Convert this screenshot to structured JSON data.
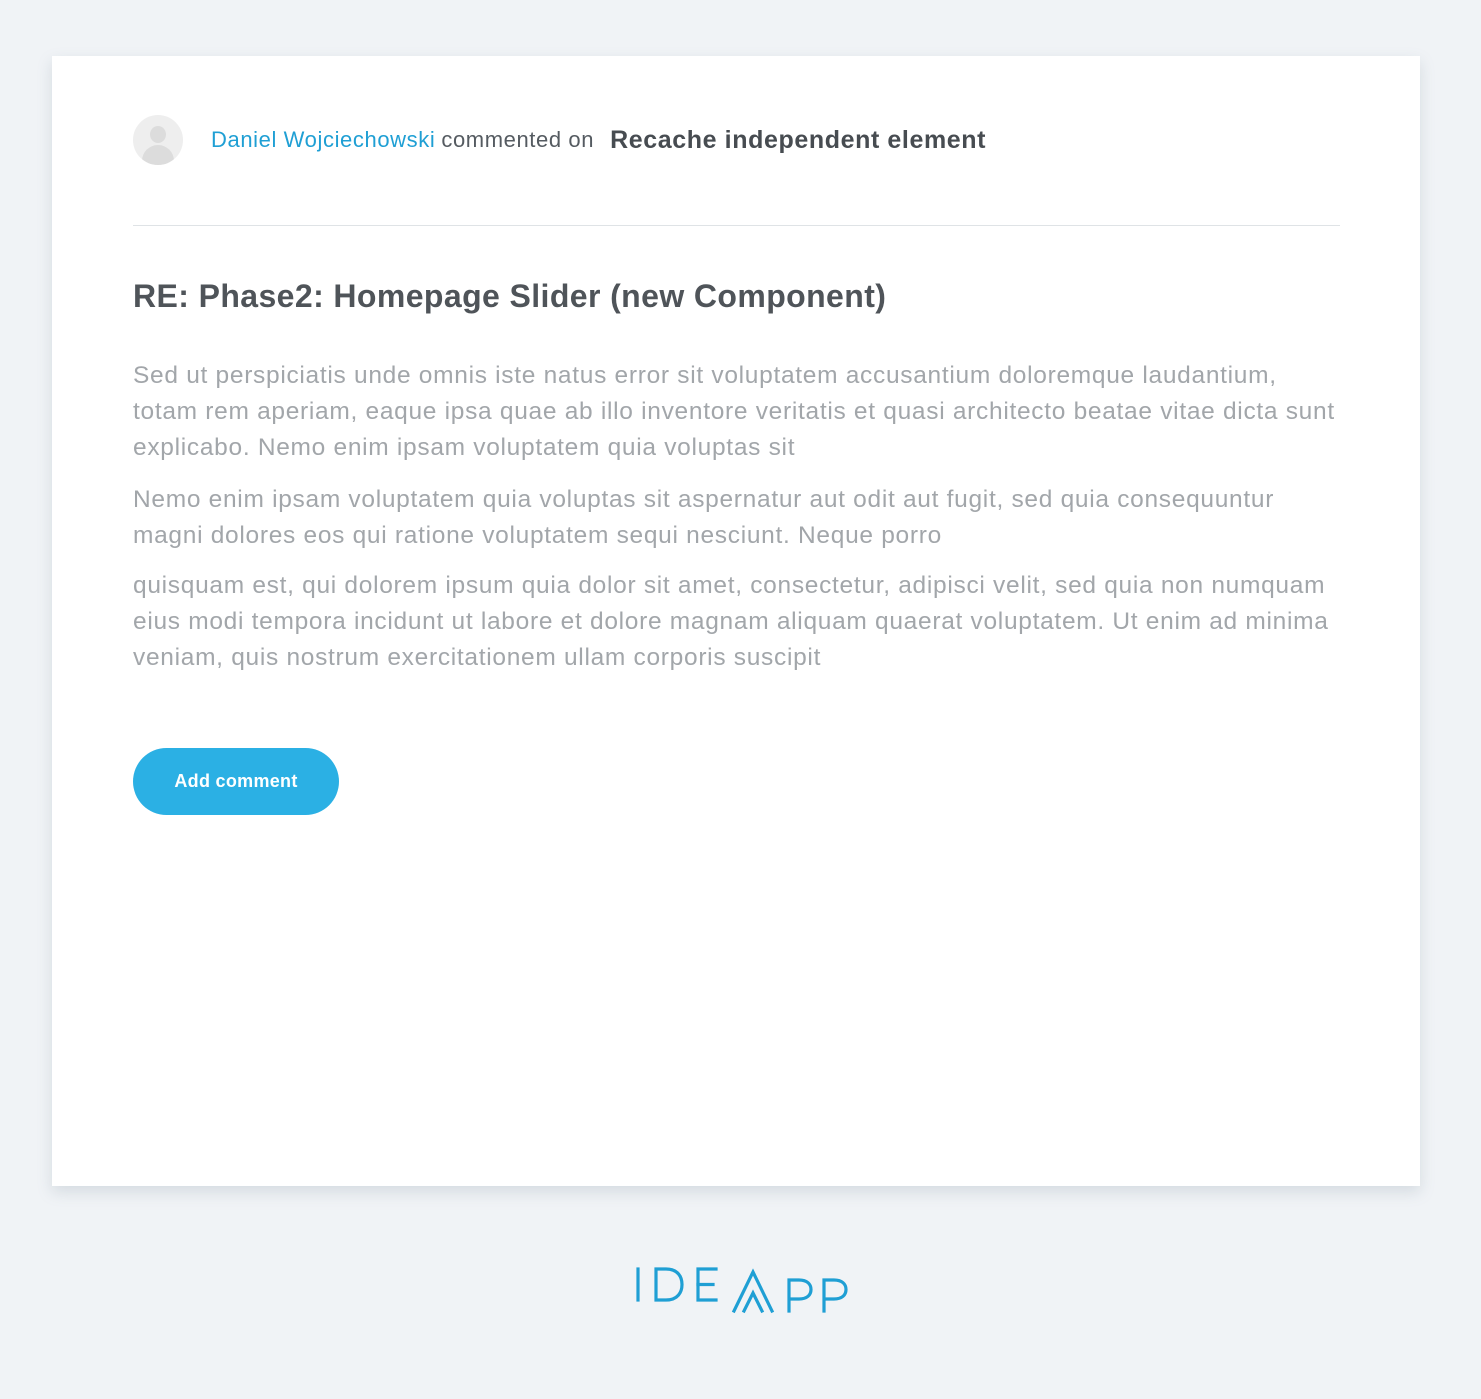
{
  "notification": {
    "author": "Daniel Wojciechowski",
    "action": "commented on",
    "target": "Recache independent element"
  },
  "comment": {
    "subject": "RE: Phase2: Homepage Slider (new Component)",
    "paragraphs": [
      "Sed ut perspiciatis unde omnis iste natus error sit voluptatem accusantium doloremque laudantium, totam rem aperiam, eaque ipsa quae ab illo inventore veritatis et quasi architecto beatae vitae dicta sunt explicabo. Nemo enim ipsam voluptatem quia voluptas sit",
      "Nemo enim ipsam voluptatem quia voluptas sit aspernatur aut odit aut fugit, sed quia consequuntur magni dolores eos qui ratione voluptatem sequi nesciunt. Neque porro",
      "quisquam est, qui dolorem ipsum quia dolor sit amet, consectetur, adipisci velit, sed quia non numquam eius modi tempora incidunt ut labore et dolore magnam aliquam quaerat voluptatem. Ut enim ad minima veniam, quis nostrum exercitationem ullam corporis suscipit"
    ]
  },
  "actions": {
    "add_comment_label": "Add comment"
  },
  "footer": {
    "logo_text": "IDEAPP"
  },
  "colors": {
    "accent": "#2bb0e4",
    "link": "#1f9fd4",
    "background": "#f0f3f6"
  }
}
